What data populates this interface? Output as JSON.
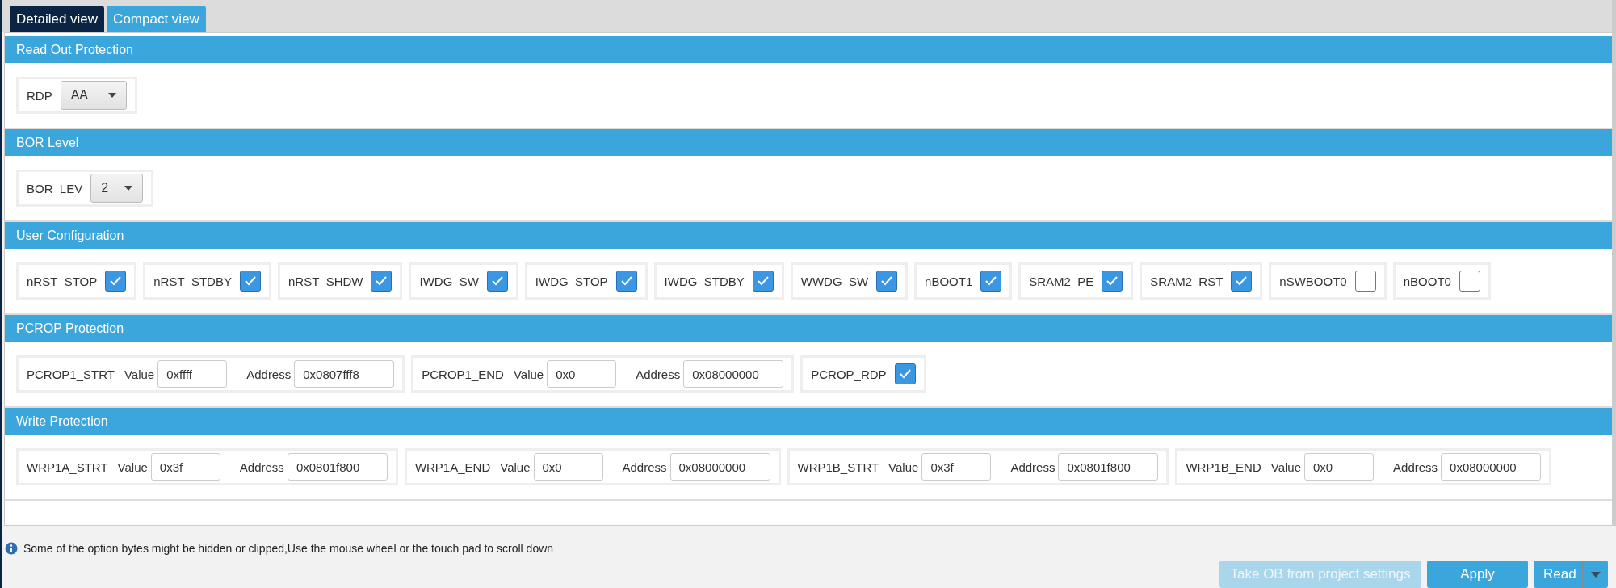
{
  "tabs": [
    {
      "label": "Detailed view",
      "selected": true
    },
    {
      "label": "Compact view",
      "selected": false
    }
  ],
  "sections": [
    {
      "title": "Read Out Protection",
      "items": [
        {
          "kind": "select",
          "label": "RDP",
          "value": "AA"
        }
      ]
    },
    {
      "title": "BOR Level",
      "items": [
        {
          "kind": "select",
          "label": "BOR_LEV",
          "value": "2"
        }
      ]
    },
    {
      "title": "User Configuration",
      "items": [
        {
          "kind": "checkbox",
          "label": "nRST_STOP",
          "checked": true
        },
        {
          "kind": "checkbox",
          "label": "nRST_STDBY",
          "checked": true
        },
        {
          "kind": "checkbox",
          "label": "nRST_SHDW",
          "checked": true
        },
        {
          "kind": "checkbox",
          "label": "IWDG_SW",
          "checked": true
        },
        {
          "kind": "checkbox",
          "label": "IWDG_STOP",
          "checked": true
        },
        {
          "kind": "checkbox",
          "label": "IWDG_STDBY",
          "checked": true
        },
        {
          "kind": "checkbox",
          "label": "WWDG_SW",
          "checked": true
        },
        {
          "kind": "checkbox",
          "label": "nBOOT1",
          "checked": true
        },
        {
          "kind": "checkbox",
          "label": "SRAM2_PE",
          "checked": true
        },
        {
          "kind": "checkbox",
          "label": "SRAM2_RST",
          "checked": true
        },
        {
          "kind": "checkbox",
          "label": "nSWBOOT0",
          "checked": false
        },
        {
          "kind": "checkbox",
          "label": "nBOOT0",
          "checked": false
        }
      ]
    },
    {
      "title": "PCROP Protection",
      "items": [
        {
          "kind": "range",
          "label": "PCROP1_STRT",
          "value_label": "Value",
          "value": "0xffff",
          "address_label": "Address",
          "address": "0x0807fff8"
        },
        {
          "kind": "range",
          "label": "PCROP1_END",
          "value_label": "Value",
          "value": "0x0",
          "address_label": "Address",
          "address": "0x08000000"
        },
        {
          "kind": "checkbox",
          "label": "PCROP_RDP",
          "checked": true
        }
      ]
    },
    {
      "title": "Write Protection",
      "items": [
        {
          "kind": "range",
          "label": "WRP1A_STRT",
          "value_label": "Value",
          "value": "0x3f",
          "address_label": "Address",
          "address": "0x0801f800"
        },
        {
          "kind": "range",
          "label": "WRP1A_END",
          "value_label": "Value",
          "value": "0x0",
          "address_label": "Address",
          "address": "0x08000000"
        },
        {
          "kind": "range",
          "label": "WRP1B_STRT",
          "value_label": "Value",
          "value": "0x3f",
          "address_label": "Address",
          "address": "0x0801f800"
        },
        {
          "kind": "range",
          "label": "WRP1B_END",
          "value_label": "Value",
          "value": "0x0",
          "address_label": "Address",
          "address": "0x08000000"
        }
      ]
    }
  ],
  "info": "Some of the option bytes might be hidden or clipped,Use the mouse wheel or the touch pad to scroll down",
  "buttons": [
    {
      "label": "Take OB from project settings",
      "disabled": true,
      "dropdown": false
    },
    {
      "label": "Apply",
      "disabled": false,
      "dropdown": false
    },
    {
      "label": "Read",
      "disabled": false,
      "dropdown": true
    }
  ]
}
